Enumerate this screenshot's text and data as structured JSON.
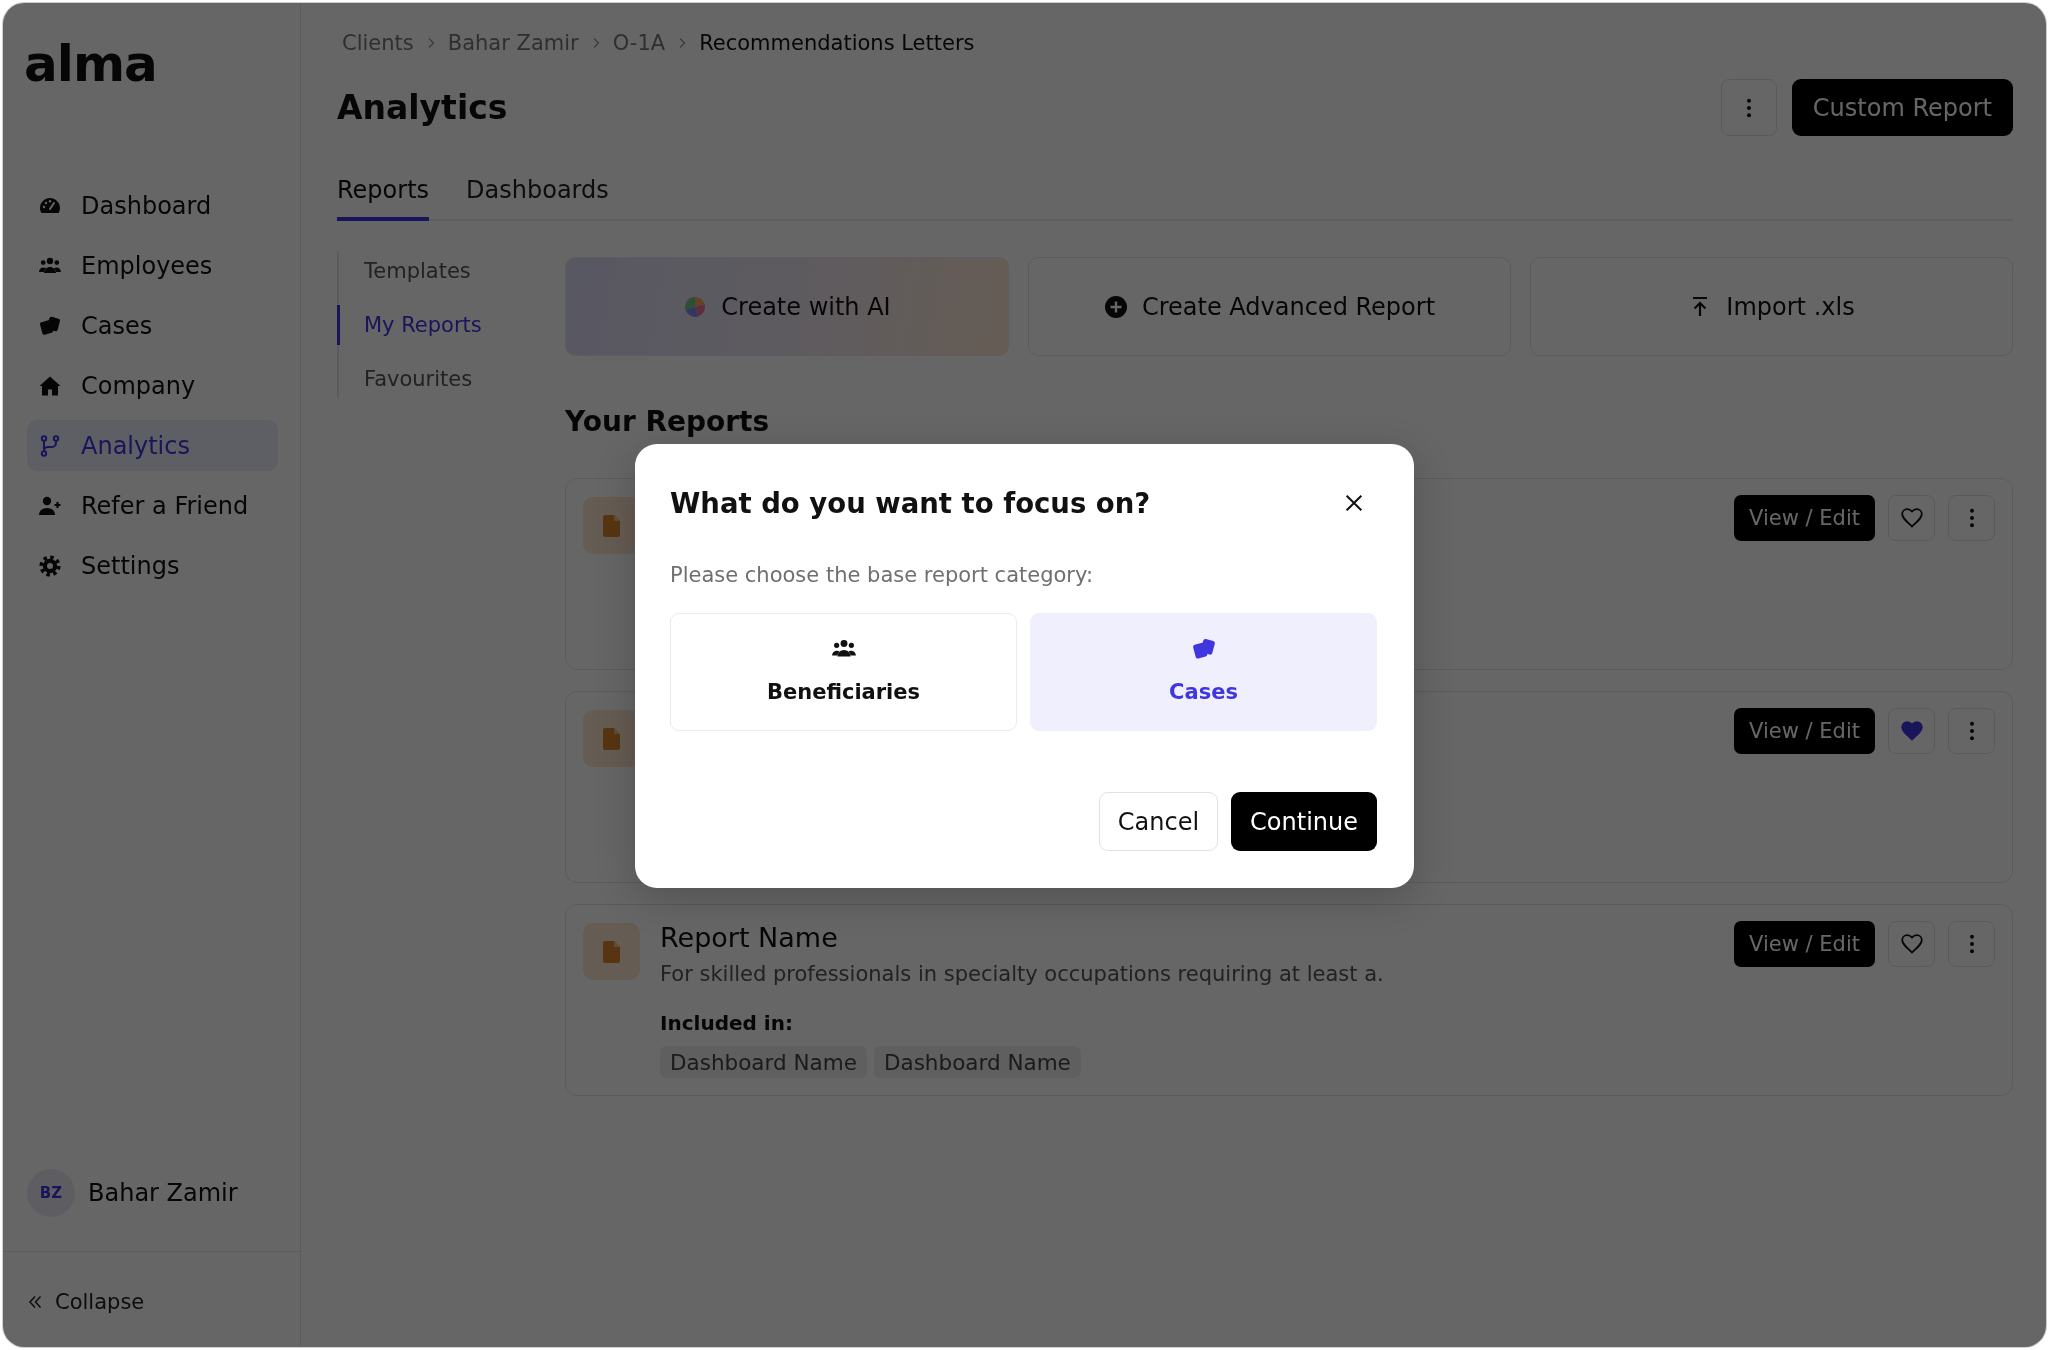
{
  "sidebar": {
    "logo": "alma",
    "nav": [
      {
        "label": "Dashboard",
        "selected": false
      },
      {
        "label": "Employees",
        "selected": false
      },
      {
        "label": "Cases",
        "selected": false
      },
      {
        "label": "Company",
        "selected": false
      },
      {
        "label": "Analytics",
        "selected": true
      },
      {
        "label": "Refer a Friend",
        "selected": false
      },
      {
        "label": "Settings",
        "selected": false
      }
    ],
    "user": {
      "initials": "BZ",
      "name": "Bahar Zamir"
    },
    "collapse": "Collapse"
  },
  "breadcrumbs": [
    "Clients",
    "Bahar Zamir",
    "O-1A",
    "Recommendations Letters"
  ],
  "page": {
    "title": "Analytics",
    "primary_button": "Custom Report"
  },
  "tabs": [
    {
      "label": "Reports",
      "selected": true
    },
    {
      "label": "Dashboards",
      "selected": false
    }
  ],
  "subnav": [
    {
      "label": "Templates",
      "selected": false
    },
    {
      "label": "My Reports",
      "selected": true
    },
    {
      "label": "Favourites",
      "selected": false
    }
  ],
  "actions": [
    {
      "kind": "ai",
      "label": "Create with AI"
    },
    {
      "kind": "advanced",
      "label": "Create Advanced Report"
    },
    {
      "kind": "import",
      "label": "Import .xls"
    }
  ],
  "reports_heading": "Your Reports",
  "reports": [
    {
      "button": "View / Edit",
      "favourite": false
    },
    {
      "button": "View / Edit",
      "favourite": true
    },
    {
      "title": "Report Name",
      "description": "For skilled professionals in specialty occupations requiring at least a.",
      "included_label": "Included in:",
      "dashboards": [
        "Dashboard Name",
        "Dashboard Name"
      ],
      "button": "View / Edit",
      "favourite": false
    }
  ],
  "modal": {
    "title": "What do you want to focus on?",
    "prompt": "Please choose the base report category:",
    "options": [
      {
        "label": "Beneficiaries",
        "selected": false
      },
      {
        "label": "Cases",
        "selected": true
      }
    ],
    "cancel": "Cancel",
    "confirm": "Continue"
  }
}
